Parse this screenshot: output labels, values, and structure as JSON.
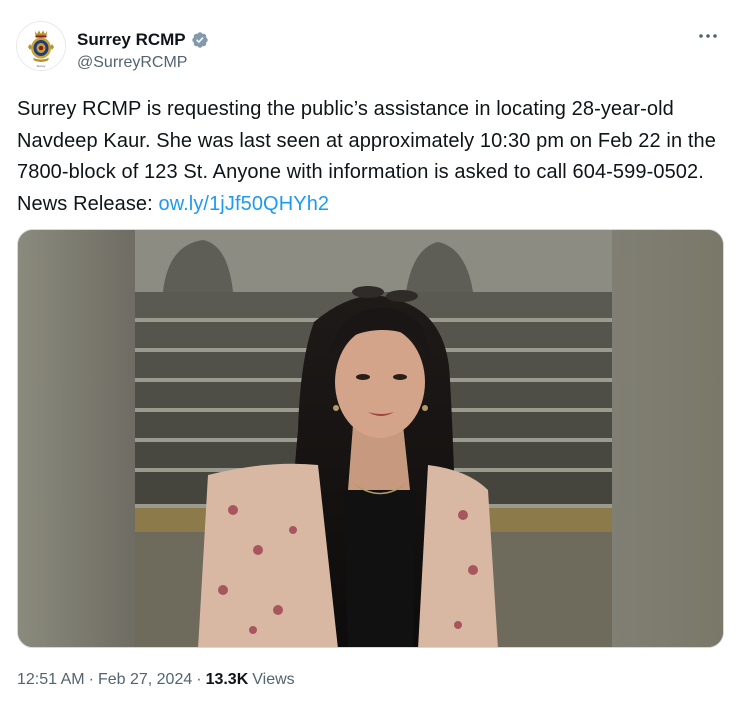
{
  "account": {
    "display_name": "Surrey RCMP",
    "handle": "@SurreyRCMP",
    "verified": true,
    "avatar_caption": "Surrey"
  },
  "tweet": {
    "text_before_link": "Surrey RCMP is requesting the public’s assistance in locating 28-year-old Navdeep Kaur. She was last seen at approximately 10:30 pm on Feb 22 in the 7800-block of 123 St.  Anyone with information is asked to call 604-599-0502. News Release: ",
    "link_text": "ow.ly/1jJf50QHYh2"
  },
  "meta": {
    "time": "12:51 AM",
    "separator": "·",
    "date": "Feb 27, 2024",
    "views_count": "13.3K",
    "views_label": "Views"
  },
  "icons": {
    "verified": "verified-badge-icon",
    "more": "more-options-icon"
  },
  "colors": {
    "link": "#1d9bf0",
    "secondary_text": "#536471",
    "verified_badge": "#829aab"
  }
}
